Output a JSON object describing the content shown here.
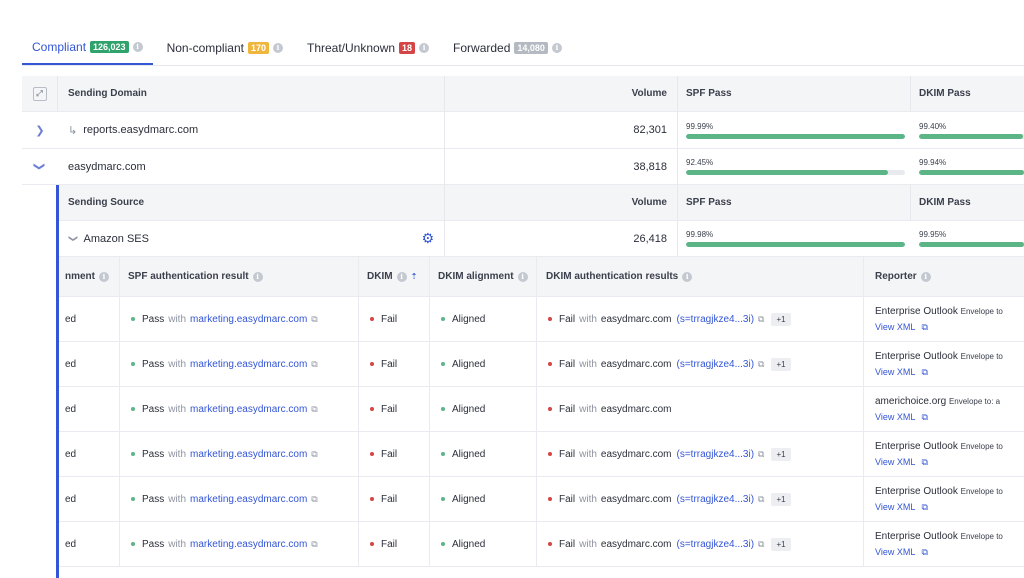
{
  "tabs": [
    {
      "label": "Compliant",
      "count": "126,023",
      "badge_color": "#2fa36b",
      "active": true
    },
    {
      "label": "Non-compliant",
      "count": "170",
      "badge_color": "#f0b63c",
      "active": false
    },
    {
      "label": "Threat/Unknown",
      "count": "18",
      "badge_color": "#d64545",
      "active": false
    },
    {
      "label": "Forwarded",
      "count": "14,080",
      "badge_color": "#b5b9c2",
      "active": false
    }
  ],
  "domain_table": {
    "headers": {
      "domain": "Sending Domain",
      "volume": "Volume",
      "spf": "SPF Pass",
      "dkim": "DKIM Pass"
    },
    "rows": [
      {
        "name": "reports.easydmarc.com",
        "volume": "82,301",
        "spf_label": "99.99%",
        "spf": 0.9999,
        "dkim_label": "99.40%",
        "dkim": 0.994
      },
      {
        "name": "easydmarc.com",
        "volume": "38,818",
        "spf_label": "92.45%",
        "spf": 0.9245,
        "dkim_label": "99.94%",
        "dkim": 0.9994
      }
    ]
  },
  "source_table": {
    "headers": {
      "source": "Sending Source",
      "volume": "Volume",
      "spf": "SPF Pass",
      "dkim": "DKIM Pass"
    },
    "row": {
      "name": "Amazon SES",
      "volume": "26,418",
      "spf_label": "99.98%",
      "spf": 0.9998,
      "dkim_label": "99.95%",
      "dkim": 0.9995
    }
  },
  "detail_table": {
    "headers": {
      "alignment": "nment",
      "spf_auth": "SPF authentication result",
      "dkim": "DKIM",
      "dkim_align": "DKIM alignment",
      "dkim_auth": "DKIM authentication results",
      "reporter": "Reporter"
    },
    "common": {
      "align_value": "ed",
      "pass": "Pass",
      "fail": "Fail",
      "with": "with",
      "aligned": "Aligned",
      "spf_domain": "marketing.easydmarc.com",
      "dkim_domain": "easydmarc.com",
      "selector": "(s=trragjkze4...3i)",
      "extra": "+1",
      "view_xml": "View XML",
      "envelope": "Envelope to",
      "envelope_alt": "Envelope to: a"
    },
    "rows": [
      {
        "reporter": "Enterprise Outlook",
        "selector": true
      },
      {
        "reporter": "Enterprise Outlook",
        "selector": true
      },
      {
        "reporter": "americhoice.org",
        "selector": false
      },
      {
        "reporter": "Enterprise Outlook",
        "selector": true
      },
      {
        "reporter": "Enterprise Outlook",
        "selector": true
      },
      {
        "reporter": "Enterprise Outlook",
        "selector": true
      }
    ]
  }
}
